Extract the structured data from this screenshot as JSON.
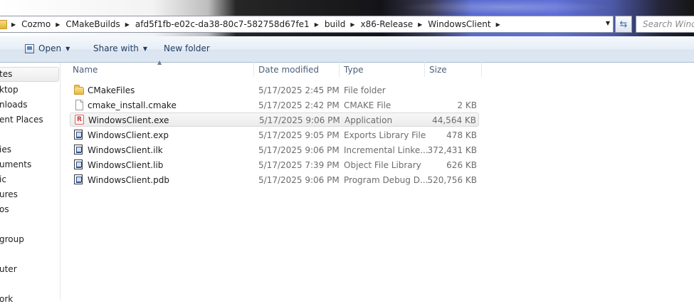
{
  "address_bar": {
    "breadcrumbs": [
      "Cozmo",
      "CMakeBuilds",
      "afd5f1fb-e02c-da38-80c7-582758d67fe1",
      "build",
      "x86-Release",
      "WindowsClient"
    ],
    "search_placeholder": "Search Windo"
  },
  "toolbar": {
    "open_label": "Open",
    "share_label": "Share with",
    "new_folder_label": "New folder"
  },
  "nav": {
    "items": [
      "tes",
      "ktop",
      "nloads",
      "ent Places",
      "ies",
      "uments",
      "ic",
      "ures",
      "os",
      "group",
      "uter",
      "ork"
    ]
  },
  "columns": {
    "name": "Name",
    "date": "Date modified",
    "type": "Type",
    "size": "Size"
  },
  "files": [
    {
      "name": "CMakeFiles",
      "date": "5/17/2025 2:45 PM",
      "type": "File folder",
      "size": "",
      "icon": "folder-icon"
    },
    {
      "name": "cmake_install.cmake",
      "date": "5/17/2025 2:42 PM",
      "type": "CMAKE File",
      "size": "2 KB",
      "icon": "document-icon"
    },
    {
      "name": "WindowsClient.exe",
      "date": "5/17/2025 9:06 PM",
      "type": "Application",
      "size": "44,564 KB",
      "icon": "application-icon"
    },
    {
      "name": "WindowsClient.exp",
      "date": "5/17/2025 9:05 PM",
      "type": "Exports Library File",
      "size": "478 KB",
      "icon": "library-file-icon"
    },
    {
      "name": "WindowsClient.ilk",
      "date": "5/17/2025 9:06 PM",
      "type": "Incremental Linke...",
      "size": "372,431 KB",
      "icon": "library-file-icon"
    },
    {
      "name": "WindowsClient.lib",
      "date": "5/17/2025 7:39 PM",
      "type": "Object File Library",
      "size": "626 KB",
      "icon": "library-file-icon"
    },
    {
      "name": "WindowsClient.pdb",
      "date": "5/17/2025 9:06 PM",
      "type": "Program Debug D...",
      "size": "520,756 KB",
      "icon": "library-file-icon"
    }
  ]
}
